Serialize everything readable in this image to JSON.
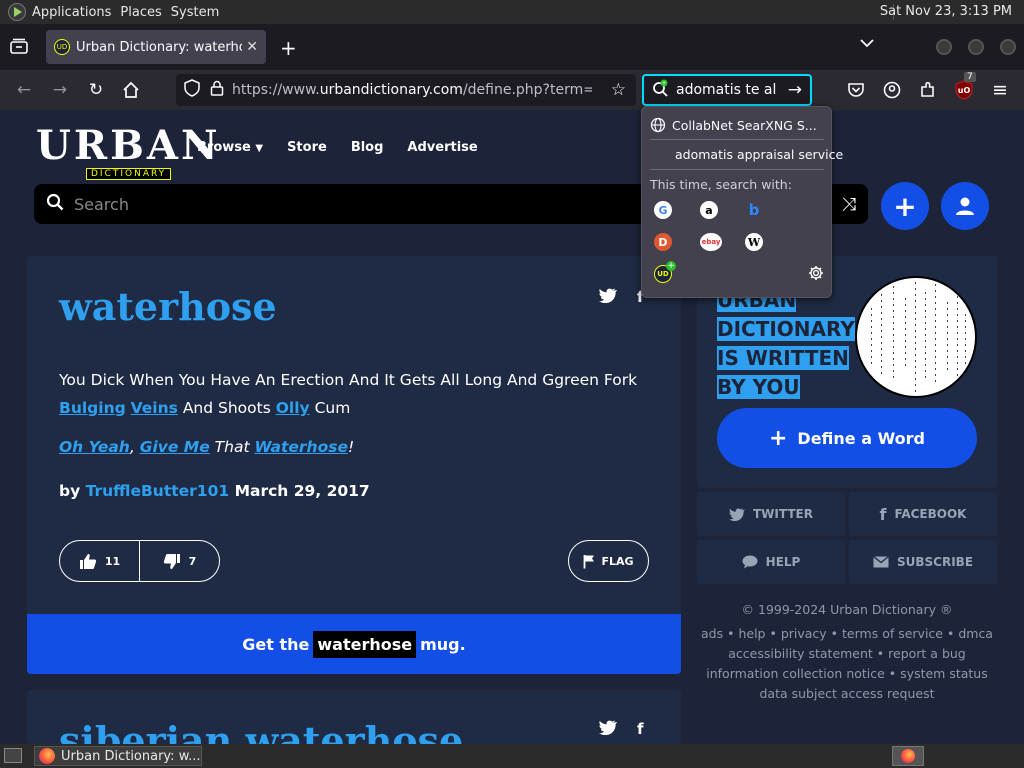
{
  "system": {
    "menus": [
      "Applications",
      "Places",
      "System"
    ],
    "clock": "Sat Nov 23,  3:13 PM"
  },
  "browser": {
    "tab_title": "Urban Dictionary: waterhose",
    "url_prefix": "https://www.",
    "url_domain": "urbandictionary.com",
    "url_rest": "/define.php?term=waterhose",
    "search_query": "adomatis te al",
    "ublock_badge": "7"
  },
  "search_dropdown": {
    "engine_header": "CollabNet SearXNG S...",
    "suggestion": "adomatis appraisal service",
    "this_time_label": "This time, search with:",
    "engines": [
      "google-icon",
      "amazon-icon",
      "bing-icon",
      "duckduckgo-icon",
      "ebay-icon",
      "wikipedia-icon",
      "searxng-add-icon"
    ]
  },
  "site": {
    "logo_word": "URBAN",
    "logo_sub": "DICTIONARY",
    "nav": [
      "Browse",
      "Store",
      "Blog",
      "Advertise"
    ],
    "search_placeholder": "Search"
  },
  "definition": {
    "word": "waterhose",
    "meaning_pre": "You Dick When You Have An Erection And It Gets All Long And Ggreen Fork",
    "link1": "Bulging",
    "link2": "Veins",
    "meaning_mid": "And Shoots",
    "link3": "Olly",
    "meaning_end": "Cum",
    "ex_link1": "Oh Yeah",
    "ex_comma": ",",
    "ex_link2": "Give Me",
    "ex_mid": "That",
    "ex_link3": "Waterhose",
    "ex_end": "!",
    "by_label": "by",
    "author": "TruffleButter101",
    "date": "March 29, 2017",
    "upvotes": "11",
    "downvotes": "7",
    "flag_label": "FLAG",
    "mug_pre": "Get the",
    "mug_word": "waterhose",
    "mug_post": "mug."
  },
  "definition2": {
    "word": "siberian waterhose"
  },
  "sidebar": {
    "written_lines": [
      "URBAN",
      "DICTIONARY",
      "IS WRITTEN",
      "BY YOU"
    ],
    "define_label": "Define a Word",
    "social": [
      "TWITTER",
      "FACEBOOK",
      "HELP",
      "SUBSCRIBE"
    ],
    "copyright": "© 1999-2024 Urban Dictionary ®",
    "footer_line1": [
      "ads",
      "help",
      "privacy",
      "terms of service",
      "dmca"
    ],
    "footer_line2": [
      "accessibility statement",
      "report a bug"
    ],
    "footer_line3": [
      "information collection notice",
      "system status"
    ],
    "footer_line4": "data subject access request"
  },
  "taskbar": {
    "task_title": "Urban Dictionary: w..."
  },
  "colors": {
    "brand_blue": "#134fe6",
    "link_blue": "#2fa0f0",
    "page_bg": "#1d2439",
    "card_bg": "#1f2b44",
    "logo_yellow": "#efff00"
  }
}
